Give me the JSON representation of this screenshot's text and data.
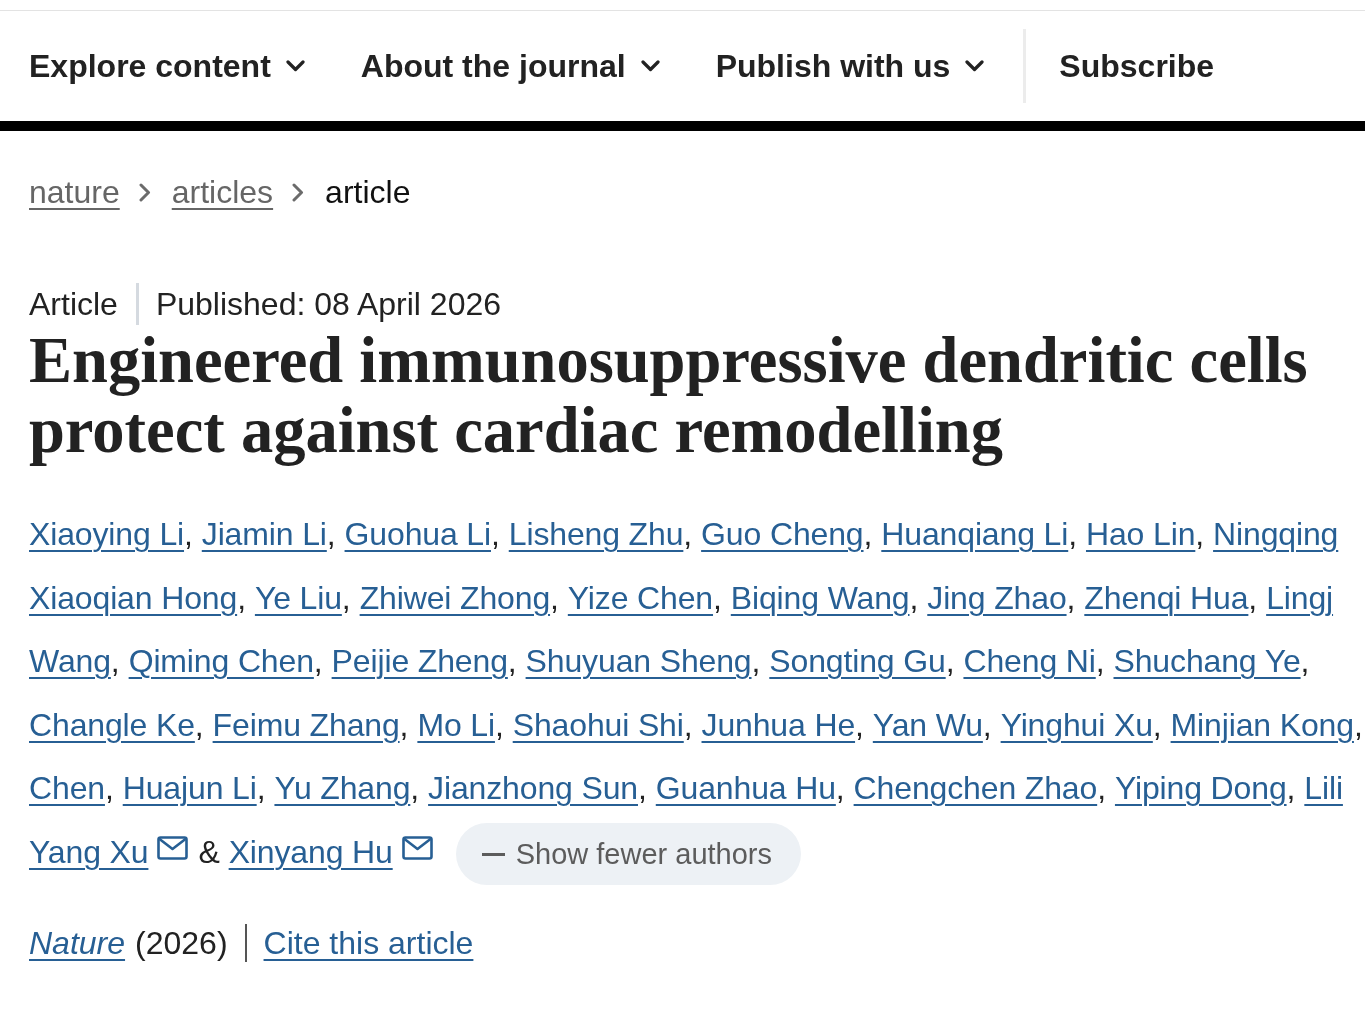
{
  "nav": {
    "items": [
      {
        "label": "Explore content",
        "kind": "dropdown"
      },
      {
        "label": "About the journal",
        "kind": "dropdown"
      },
      {
        "label": "Publish with us",
        "kind": "dropdown"
      },
      {
        "label": "Subscribe",
        "kind": "link"
      }
    ]
  },
  "breadcrumbs": [
    {
      "label": "nature",
      "current": false
    },
    {
      "label": "articles",
      "current": false
    },
    {
      "label": "article",
      "current": true
    }
  ],
  "article_type": "Article",
  "published": "Published: 08 April 2026",
  "title": "Engineered immunosuppressive dendritic cells protect against cardiac remodelling",
  "author_lines": [
    [
      {
        "name": "Xiaoying Li",
        "separator": ",",
        "email": false
      },
      {
        "name": "Jiamin Li",
        "separator": ",",
        "email": false
      },
      {
        "name": "Guohua Li",
        "separator": ",",
        "email": false
      },
      {
        "name": "Lisheng Zhu",
        "separator": ",",
        "email": false
      },
      {
        "name": "Guo Cheng",
        "separator": ",",
        "email": false
      },
      {
        "name": "Huanqiang Li",
        "separator": ",",
        "email": false
      },
      {
        "name": "Hao Lin",
        "separator": ",",
        "email": false
      },
      {
        "name": "Ningqing",
        "email": false
      }
    ],
    [
      {
        "name": "Xiaoqian Hong",
        "separator": ",",
        "email": false
      },
      {
        "name": "Ye Liu",
        "separator": ",",
        "email": false
      },
      {
        "name": "Zhiwei Zhong",
        "separator": ",",
        "email": false
      },
      {
        "name": "Yize Chen",
        "separator": ",",
        "email": false
      },
      {
        "name": "Biqing Wang",
        "separator": ",",
        "email": false
      },
      {
        "name": "Jing Zhao",
        "separator": ",",
        "email": false
      },
      {
        "name": "Zhenqi Hua",
        "separator": ",",
        "email": false
      },
      {
        "name": "Lingj",
        "email": false
      }
    ],
    [
      {
        "name": "Wang",
        "separator": ",",
        "email": false
      },
      {
        "name": "Qiming Chen",
        "separator": ",",
        "email": false
      },
      {
        "name": "Peijie Zheng",
        "separator": ",",
        "email": false
      },
      {
        "name": "Shuyuan Sheng",
        "separator": ",",
        "email": false
      },
      {
        "name": "Songting Gu",
        "separator": ",",
        "email": false
      },
      {
        "name": "Cheng Ni",
        "separator": ",",
        "email": false
      },
      {
        "name": "Shuchang Ye",
        "separator": ",",
        "email": false
      }
    ],
    [
      {
        "name": "Changle Ke",
        "separator": ",",
        "email": false
      },
      {
        "name": "Feimu Zhang",
        "separator": ",",
        "email": false
      },
      {
        "name": "Mo Li",
        "separator": ",",
        "email": false
      },
      {
        "name": "Shaohui Shi",
        "separator": ",",
        "email": false
      },
      {
        "name": "Junhua He",
        "separator": ",",
        "email": false
      },
      {
        "name": "Yan Wu",
        "separator": ",",
        "email": false
      },
      {
        "name": "Yinghui Xu",
        "separator": ",",
        "email": false
      },
      {
        "name": "Minjian Kong",
        "separator": ",",
        "email": false
      }
    ],
    [
      {
        "name": "Chen",
        "separator": ",",
        "email": false
      },
      {
        "name": "Huajun Li",
        "separator": ",",
        "email": false
      },
      {
        "name": "Yu Zhang",
        "separator": ",",
        "email": false
      },
      {
        "name": "Jianzhong Sun",
        "separator": ",",
        "email": false
      },
      {
        "name": "Guanhua Hu",
        "separator": ",",
        "email": false
      },
      {
        "name": "Chengchen Zhao",
        "separator": ",",
        "email": false
      },
      {
        "name": "Yiping Dong",
        "separator": ",",
        "email": false
      },
      {
        "name": "Lili",
        "email": false
      }
    ],
    [
      {
        "name": "Yang Xu",
        "separator": "&",
        "email": true
      },
      {
        "name": "Xinyang Hu",
        "email": true
      }
    ]
  ],
  "authors_toggle": {
    "label": "Show fewer authors",
    "expanded": true
  },
  "citation": {
    "journal": "Nature",
    "year": "(2026)",
    "cite_link": "Cite this article"
  }
}
